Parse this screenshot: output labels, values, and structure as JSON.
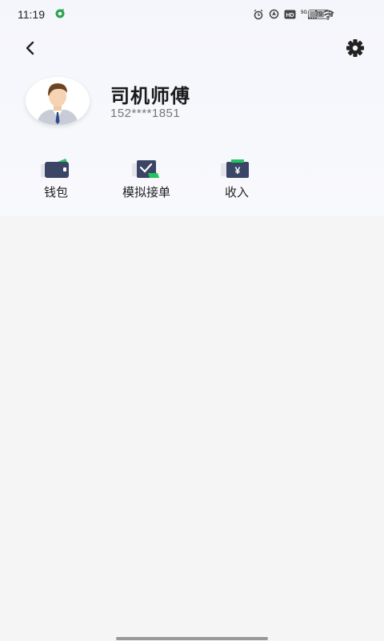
{
  "status_bar": {
    "time": "11:19",
    "battery_level": "79",
    "battery_fraction": 0.79,
    "icons": [
      "alarm-icon",
      "location-icon",
      "hd-icon",
      "signal-5g-icon",
      "wifi-icon",
      "battery-icon"
    ]
  },
  "header": {
    "back_icon": "chevron-left-icon",
    "settings_icon": "gear-icon"
  },
  "profile": {
    "name": "司机师傅",
    "phone": "152****1851"
  },
  "actions": [
    {
      "label": "钱包",
      "icon": "wallet-icon"
    },
    {
      "label": "模拟接单",
      "icon": "simulate-order-icon"
    },
    {
      "label": "收入",
      "icon": "income-icon"
    }
  ],
  "colors": {
    "accent_green": "#22c55e",
    "icon_navy": "#3b4566",
    "background": "#f5f5f5",
    "panel": "#f7f8fc"
  }
}
